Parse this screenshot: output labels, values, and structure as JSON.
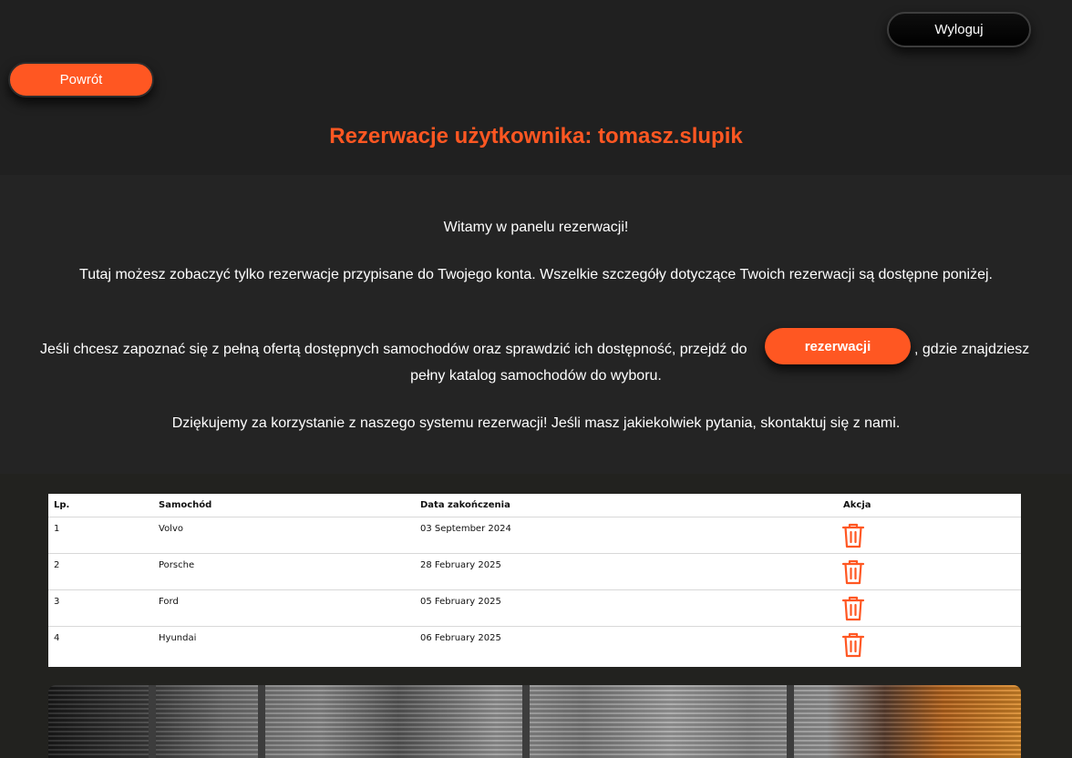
{
  "header": {
    "logout_label": "Wyloguj",
    "back_label": "Powrót",
    "title": "Rezerwacje użytkownika: tomasz.slupik"
  },
  "info": {
    "welcome": "Witamy w panelu rezerwacji!",
    "description": "Tutaj możesz zobaczyć tylko rezerwacje przypisane do Twojego konta. Wszelkie szczegóły dotyczące Twoich rezerwacji są dostępne poniżej.",
    "offer_before": "Jeśli chcesz zapoznać się z pełną ofertą dostępnych samochodów oraz sprawdzić ich dostępność, przejdź do",
    "offer_link": "rezerwacji",
    "offer_after": ", gdzie znajdziesz",
    "offer_line2": "pełny katalog samochodów do wyboru.",
    "thanks": "Dziękujemy za korzystanie z naszego systemu rezerwacji! Jeśli masz jakiekolwiek pytania, skontaktuj się z nami."
  },
  "table": {
    "headers": {
      "lp": "Lp.",
      "car": "Samochód",
      "end_date": "Data zakończenia",
      "action": "Akcja"
    },
    "rows": [
      {
        "lp": "1",
        "car": "Volvo",
        "end_date": "03 September 2024",
        "action_icon": "trash-icon"
      },
      {
        "lp": "2",
        "car": "Porsche",
        "end_date": "28 February 2025",
        "action_icon": "trash-icon"
      },
      {
        "lp": "3",
        "car": "Ford",
        "end_date": "05 February 2025",
        "action_icon": "trash-icon"
      },
      {
        "lp": "4",
        "car": "Hyundai",
        "end_date": "06 February 2025",
        "action_icon": "trash-icon"
      }
    ]
  },
  "colors": {
    "accent": "#ff5722",
    "background": "#22221f",
    "panel": "#242424"
  }
}
